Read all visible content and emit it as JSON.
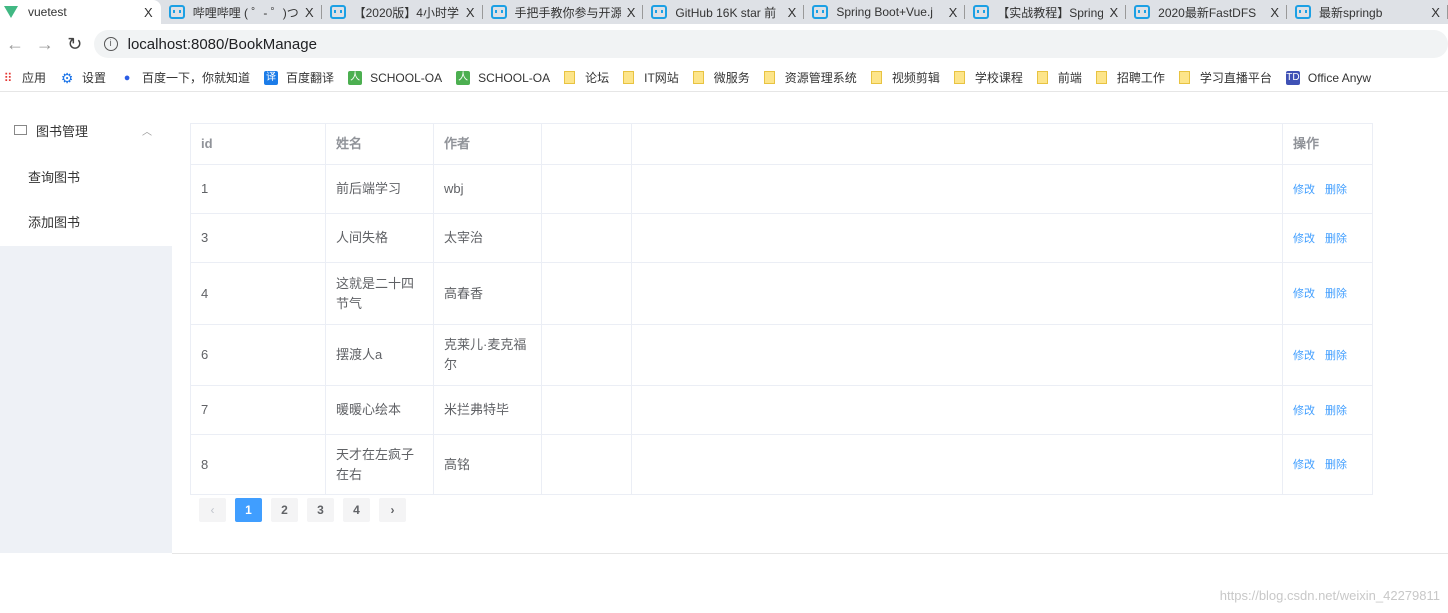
{
  "browser": {
    "tabs": [
      {
        "title": "vuetest",
        "icon": "vue-icon",
        "active": true
      },
      {
        "title": "哔哩哔哩 ( ゜- ゜)つロ",
        "icon": "bilibili-icon"
      },
      {
        "title": "【2020版】4小时学",
        "icon": "bilibili-icon"
      },
      {
        "title": "手把手教你参与开源",
        "icon": "bilibili-icon"
      },
      {
        "title": "GitHub 16K star 前",
        "icon": "bilibili-icon"
      },
      {
        "title": "Spring Boot+Vue.j",
        "icon": "bilibili-icon"
      },
      {
        "title": "【实战教程】Spring",
        "icon": "bilibili-icon"
      },
      {
        "title": "2020最新FastDFS",
        "icon": "bilibili-icon"
      },
      {
        "title": "最新springb",
        "icon": "bilibili-icon"
      }
    ],
    "close_glyph": "X",
    "url": "localhost:8080/BookManage",
    "bookmarks": [
      {
        "label": "应用",
        "type": "apps"
      },
      {
        "label": "设置",
        "type": "gear"
      },
      {
        "label": "百度一下，你就知道",
        "type": "baidu"
      },
      {
        "label": "百度翻译",
        "type": "translate"
      },
      {
        "label": "SCHOOL-OA",
        "type": "green"
      },
      {
        "label": "SCHOOL-OA",
        "type": "green"
      },
      {
        "label": "论坛",
        "type": "folder"
      },
      {
        "label": "IT网站",
        "type": "folder"
      },
      {
        "label": "微服务",
        "type": "folder"
      },
      {
        "label": "资源管理系统",
        "type": "folder"
      },
      {
        "label": "视频剪辑",
        "type": "folder"
      },
      {
        "label": "学校课程",
        "type": "folder"
      },
      {
        "label": "前端",
        "type": "folder"
      },
      {
        "label": "招聘工作",
        "type": "folder"
      },
      {
        "label": "学习直播平台",
        "type": "folder"
      },
      {
        "label": "Office Anyw",
        "type": "td"
      }
    ]
  },
  "sidebar": {
    "menu": "图书管理",
    "items": [
      "查询图书",
      "添加图书"
    ]
  },
  "table": {
    "headers": [
      "id",
      "姓名",
      "作者",
      "",
      "操作"
    ],
    "rows": [
      [
        "1",
        "前后端学习",
        "wbj"
      ],
      [
        "3",
        "人间失格",
        "太宰治"
      ],
      [
        "4",
        "这就是二十四节气",
        "高春香"
      ],
      [
        "6",
        "摆渡人a",
        "克莱儿·麦克福尔"
      ],
      [
        "7",
        "暖暖心绘本",
        "米拦弗特毕"
      ],
      [
        "8",
        "天才在左疯子在右",
        "高铭"
      ]
    ],
    "edit_label": "修改",
    "delete_label": "删除"
  },
  "pagination": {
    "pages": [
      "1",
      "2",
      "3",
      "4"
    ],
    "current": "1",
    "prev": "‹",
    "next": "›"
  },
  "watermark": "https://blog.csdn.net/weixin_42279811",
  "colors": {
    "primary": "#409eff",
    "sidebar_bg": "#eef1f6"
  }
}
